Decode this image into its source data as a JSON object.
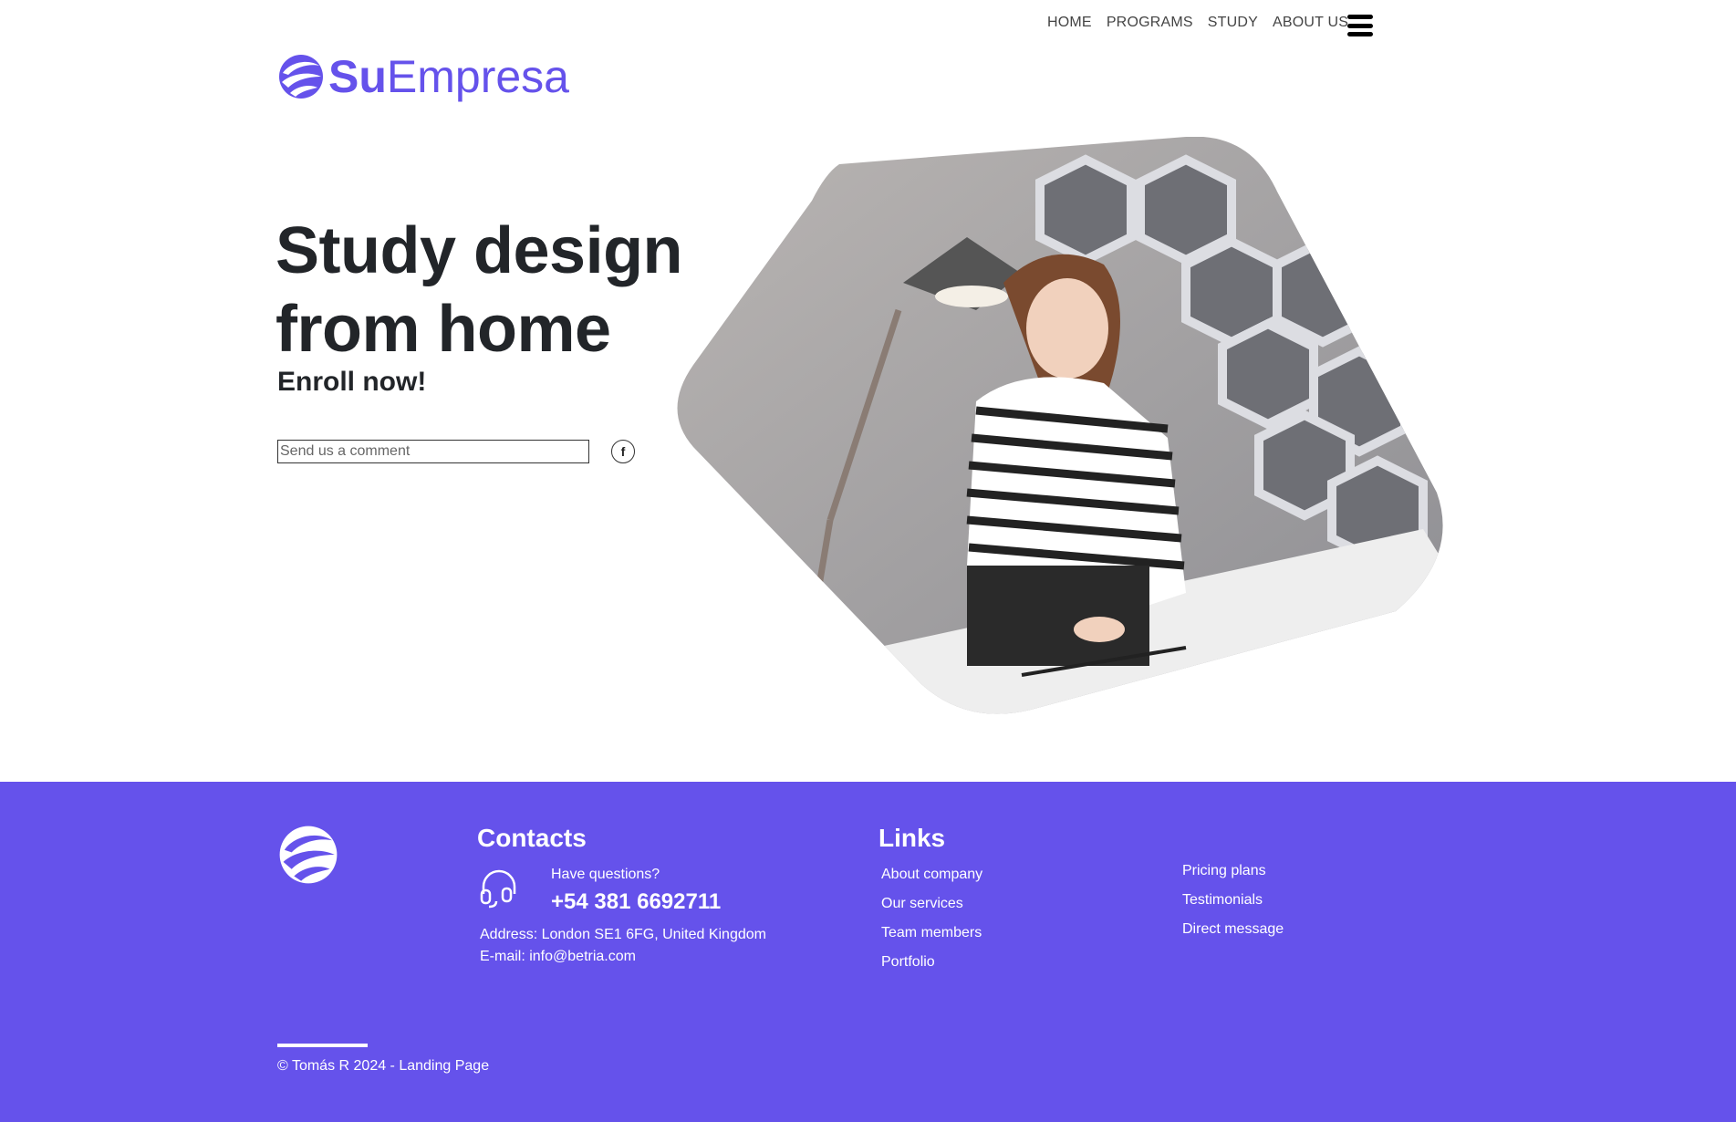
{
  "nav": {
    "items": [
      {
        "label": "HOME"
      },
      {
        "label": "PROGRAMS"
      },
      {
        "label": "STUDY"
      },
      {
        "label": "ABOUT US"
      }
    ],
    "menu_icon": "hamburger-menu-icon"
  },
  "logo": {
    "bold": "Su",
    "regular": "Empresa",
    "icon": "globe-swirl-logo-icon"
  },
  "hero": {
    "title": "Study design from home",
    "subtitle": "Enroll now!",
    "comment_placeholder": "Send us a comment",
    "facebook_icon": "facebook-icon",
    "facebook_glyph": "f",
    "image": "woman-studying-at-desk-photo"
  },
  "footer": {
    "contacts": {
      "heading": "Contacts",
      "question": "Have questions?",
      "phone": "+54 381 6692711",
      "address": "Address: London SE1 6FG, United Kingdom",
      "email": "E-mail: info@betria.com",
      "icon": "headset-icon"
    },
    "links": {
      "heading": "Links",
      "col1": [
        "About company",
        "Our services",
        "Team members",
        "Portfolio"
      ],
      "col2": [
        "Pricing plans",
        "Testimonials",
        "Direct message"
      ]
    },
    "copyright": "© Tomás R 2024 - Landing Page"
  },
  "colors": {
    "brand": "#6552eb",
    "text_dark": "#222529",
    "white": "#ffffff"
  }
}
